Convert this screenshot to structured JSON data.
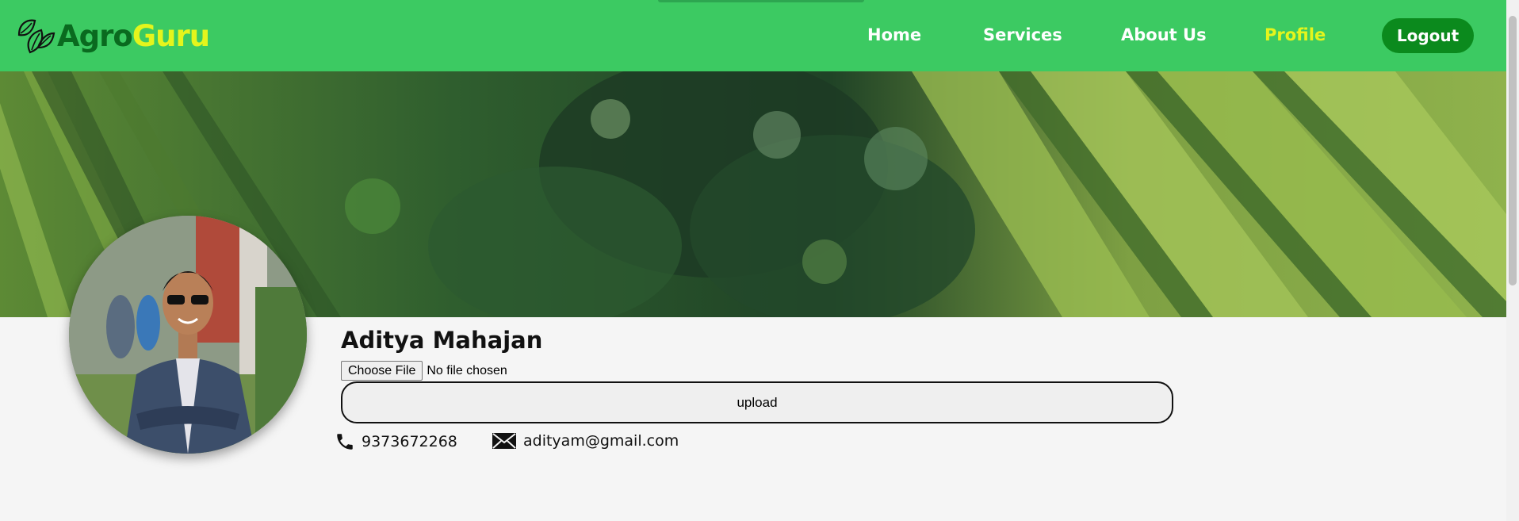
{
  "brand": {
    "name_part1": "Agro",
    "name_part2": "Guru",
    "colors": {
      "navbar": "#3cca62",
      "agro": "#0a6a1f",
      "guru": "#e4f51c",
      "logout": "#0b8a1d"
    }
  },
  "nav": {
    "items": [
      {
        "label": "Home",
        "active": false
      },
      {
        "label": "Services",
        "active": false
      },
      {
        "label": "About Us",
        "active": false
      },
      {
        "label": "Profile",
        "active": true
      }
    ],
    "logout_label": "Logout"
  },
  "banner": {
    "icon": "rice-terrace-aerial-photo"
  },
  "profile": {
    "avatar_icon": "user-photo",
    "name": "Aditya Mahajan",
    "file_input": {
      "button_label": "Choose File",
      "status": "No file chosen"
    },
    "upload_label": "upload",
    "phone": {
      "icon": "phone-icon",
      "value": "9373672268"
    },
    "email": {
      "icon": "mail-icon",
      "value": "adityam@gmail.com"
    }
  }
}
